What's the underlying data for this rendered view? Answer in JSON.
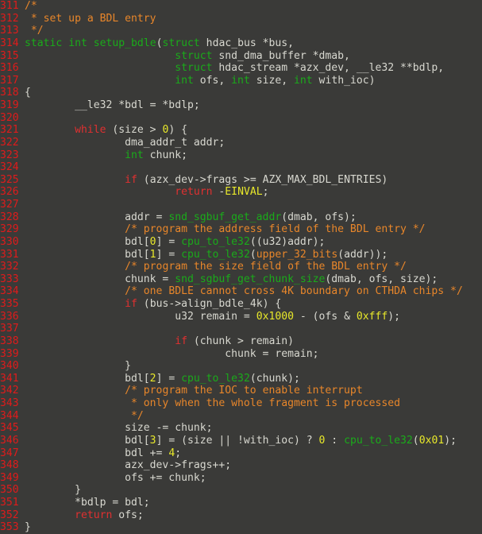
{
  "editor": {
    "language": "c",
    "first_line_number": 311,
    "last_line_number": 353,
    "colors": {
      "background": "#3a3a38",
      "line_number": "#e01b1b",
      "plain_text": "#d8d8d0",
      "keyword": "#e03030",
      "type": "#1aab1a",
      "function": "#1aab1a",
      "comment": "#e8862a",
      "number": "#e8e82a",
      "macro": "#e8862a"
    }
  },
  "lines": [
    {
      "n": "311",
      "tokens": [
        {
          "t": "/*",
          "c": "comment"
        }
      ]
    },
    {
      "n": "312",
      "tokens": [
        {
          "t": " * set up a BDL entry",
          "c": "comment"
        }
      ]
    },
    {
      "n": "313",
      "tokens": [
        {
          "t": " */",
          "c": "comment"
        }
      ]
    },
    {
      "n": "314",
      "tokens": [
        {
          "t": "static",
          "c": "type"
        },
        {
          "t": " ",
          "c": "plain"
        },
        {
          "t": "int",
          "c": "type"
        },
        {
          "t": " ",
          "c": "plain"
        },
        {
          "t": "setup_bdle",
          "c": "fn"
        },
        {
          "t": "(",
          "c": "plain"
        },
        {
          "t": "struct",
          "c": "type"
        },
        {
          "t": " hdac_bus *bus,",
          "c": "plain"
        }
      ]
    },
    {
      "n": "315",
      "tokens": [
        {
          "t": "                        ",
          "c": "plain"
        },
        {
          "t": "struct",
          "c": "type"
        },
        {
          "t": " snd_dma_buffer *dmab,",
          "c": "plain"
        }
      ]
    },
    {
      "n": "316",
      "tokens": [
        {
          "t": "                        ",
          "c": "plain"
        },
        {
          "t": "struct",
          "c": "type"
        },
        {
          "t": " hdac_stream *azx_dev, __le32 **bdlp,",
          "c": "plain"
        }
      ]
    },
    {
      "n": "317",
      "tokens": [
        {
          "t": "                        ",
          "c": "plain"
        },
        {
          "t": "int",
          "c": "type"
        },
        {
          "t": " ofs, ",
          "c": "plain"
        },
        {
          "t": "int",
          "c": "type"
        },
        {
          "t": " size, ",
          "c": "plain"
        },
        {
          "t": "int",
          "c": "type"
        },
        {
          "t": " with_ioc)",
          "c": "plain"
        }
      ]
    },
    {
      "n": "318",
      "tokens": [
        {
          "t": "{",
          "c": "plain"
        }
      ]
    },
    {
      "n": "319",
      "tokens": [
        {
          "t": "        __le32 *bdl = *bdlp;",
          "c": "plain"
        }
      ]
    },
    {
      "n": "320",
      "tokens": [
        {
          "t": "",
          "c": "plain"
        }
      ]
    },
    {
      "n": "321",
      "tokens": [
        {
          "t": "        ",
          "c": "plain"
        },
        {
          "t": "while",
          "c": "kw"
        },
        {
          "t": " (size > ",
          "c": "plain"
        },
        {
          "t": "0",
          "c": "num"
        },
        {
          "t": ") {",
          "c": "plain"
        }
      ]
    },
    {
      "n": "322",
      "tokens": [
        {
          "t": "                dma_addr_t addr;",
          "c": "plain"
        }
      ]
    },
    {
      "n": "323",
      "tokens": [
        {
          "t": "                ",
          "c": "plain"
        },
        {
          "t": "int",
          "c": "type"
        },
        {
          "t": " chunk;",
          "c": "plain"
        }
      ]
    },
    {
      "n": "324",
      "tokens": [
        {
          "t": "",
          "c": "plain"
        }
      ]
    },
    {
      "n": "325",
      "tokens": [
        {
          "t": "                ",
          "c": "plain"
        },
        {
          "t": "if",
          "c": "kw"
        },
        {
          "t": " (azx_dev->frags >= AZX_MAX_BDL_ENTRIES)",
          "c": "plain"
        }
      ]
    },
    {
      "n": "326",
      "tokens": [
        {
          "t": "                        ",
          "c": "plain"
        },
        {
          "t": "return",
          "c": "kw"
        },
        {
          "t": " -",
          "c": "plain"
        },
        {
          "t": "EINVAL",
          "c": "num"
        },
        {
          "t": ";",
          "c": "plain"
        }
      ]
    },
    {
      "n": "327",
      "tokens": [
        {
          "t": "",
          "c": "plain"
        }
      ]
    },
    {
      "n": "328",
      "tokens": [
        {
          "t": "                addr = ",
          "c": "plain"
        },
        {
          "t": "snd_sgbuf_get_addr",
          "c": "fn"
        },
        {
          "t": "(dmab, ofs);",
          "c": "plain"
        }
      ]
    },
    {
      "n": "329",
      "tokens": [
        {
          "t": "                ",
          "c": "plain"
        },
        {
          "t": "/* program the address field of the BDL entry */",
          "c": "comment"
        }
      ]
    },
    {
      "n": "330",
      "tokens": [
        {
          "t": "                bdl[",
          "c": "plain"
        },
        {
          "t": "0",
          "c": "num"
        },
        {
          "t": "] = ",
          "c": "plain"
        },
        {
          "t": "cpu_to_le32",
          "c": "fn"
        },
        {
          "t": "((u32)addr);",
          "c": "plain"
        }
      ]
    },
    {
      "n": "331",
      "tokens": [
        {
          "t": "                bdl[",
          "c": "plain"
        },
        {
          "t": "1",
          "c": "num"
        },
        {
          "t": "] = ",
          "c": "plain"
        },
        {
          "t": "cpu_to_le32",
          "c": "fn"
        },
        {
          "t": "(",
          "c": "plain"
        },
        {
          "t": "upper_32_bits",
          "c": "macro"
        },
        {
          "t": "(addr));",
          "c": "plain"
        }
      ]
    },
    {
      "n": "332",
      "tokens": [
        {
          "t": "                ",
          "c": "plain"
        },
        {
          "t": "/* program the size field of the BDL entry */",
          "c": "comment"
        }
      ]
    },
    {
      "n": "333",
      "tokens": [
        {
          "t": "                chunk = ",
          "c": "plain"
        },
        {
          "t": "snd_sgbuf_get_chunk_size",
          "c": "fn"
        },
        {
          "t": "(dmab, ofs, size);",
          "c": "plain"
        }
      ]
    },
    {
      "n": "334",
      "tokens": [
        {
          "t": "                ",
          "c": "plain"
        },
        {
          "t": "/* one BDLE cannot cross 4K boundary on CTHDA chips */",
          "c": "comment"
        }
      ]
    },
    {
      "n": "335",
      "tokens": [
        {
          "t": "                ",
          "c": "plain"
        },
        {
          "t": "if",
          "c": "kw"
        },
        {
          "t": " (bus->align_bdle_4k) {",
          "c": "plain"
        }
      ]
    },
    {
      "n": "336",
      "tokens": [
        {
          "t": "                        u32 remain = ",
          "c": "plain"
        },
        {
          "t": "0x1000",
          "c": "num"
        },
        {
          "t": " - (ofs & ",
          "c": "plain"
        },
        {
          "t": "0xfff",
          "c": "num"
        },
        {
          "t": ");",
          "c": "plain"
        }
      ]
    },
    {
      "n": "337",
      "tokens": [
        {
          "t": "",
          "c": "plain"
        }
      ]
    },
    {
      "n": "338",
      "tokens": [
        {
          "t": "                        ",
          "c": "plain"
        },
        {
          "t": "if",
          "c": "kw"
        },
        {
          "t": " (chunk > remain)",
          "c": "plain"
        }
      ]
    },
    {
      "n": "339",
      "tokens": [
        {
          "t": "                                chunk = remain;",
          "c": "plain"
        }
      ]
    },
    {
      "n": "340",
      "tokens": [
        {
          "t": "                }",
          "c": "plain"
        }
      ]
    },
    {
      "n": "341",
      "tokens": [
        {
          "t": "                bdl[",
          "c": "plain"
        },
        {
          "t": "2",
          "c": "num"
        },
        {
          "t": "] = ",
          "c": "plain"
        },
        {
          "t": "cpu_to_le32",
          "c": "fn"
        },
        {
          "t": "(chunk);",
          "c": "plain"
        }
      ]
    },
    {
      "n": "342",
      "tokens": [
        {
          "t": "                ",
          "c": "plain"
        },
        {
          "t": "/* program the IOC to enable interrupt",
          "c": "comment"
        }
      ]
    },
    {
      "n": "343",
      "tokens": [
        {
          "t": "                 * only when the whole fragment is processed",
          "c": "comment"
        }
      ]
    },
    {
      "n": "344",
      "tokens": [
        {
          "t": "                 */",
          "c": "comment"
        }
      ]
    },
    {
      "n": "345",
      "tokens": [
        {
          "t": "                size -= chunk;",
          "c": "plain"
        }
      ]
    },
    {
      "n": "346",
      "tokens": [
        {
          "t": "                bdl[",
          "c": "plain"
        },
        {
          "t": "3",
          "c": "num"
        },
        {
          "t": "] = (size || !with_ioc) ? ",
          "c": "plain"
        },
        {
          "t": "0",
          "c": "num"
        },
        {
          "t": " : ",
          "c": "plain"
        },
        {
          "t": "cpu_to_le32",
          "c": "fn"
        },
        {
          "t": "(",
          "c": "plain"
        },
        {
          "t": "0x01",
          "c": "num"
        },
        {
          "t": ");",
          "c": "plain"
        }
      ]
    },
    {
      "n": "347",
      "tokens": [
        {
          "t": "                bdl += ",
          "c": "plain"
        },
        {
          "t": "4",
          "c": "num"
        },
        {
          "t": ";",
          "c": "plain"
        }
      ]
    },
    {
      "n": "348",
      "tokens": [
        {
          "t": "                azx_dev->frags++;",
          "c": "plain"
        }
      ]
    },
    {
      "n": "349",
      "tokens": [
        {
          "t": "                ofs += chunk;",
          "c": "plain"
        }
      ]
    },
    {
      "n": "350",
      "tokens": [
        {
          "t": "        }",
          "c": "plain"
        }
      ]
    },
    {
      "n": "351",
      "tokens": [
        {
          "t": "        *bdlp = bdl;",
          "c": "plain"
        }
      ]
    },
    {
      "n": "352",
      "tokens": [
        {
          "t": "        ",
          "c": "plain"
        },
        {
          "t": "return",
          "c": "kw"
        },
        {
          "t": " ofs;",
          "c": "plain"
        }
      ]
    },
    {
      "n": "353",
      "tokens": [
        {
          "t": "}",
          "c": "plain"
        }
      ]
    }
  ]
}
